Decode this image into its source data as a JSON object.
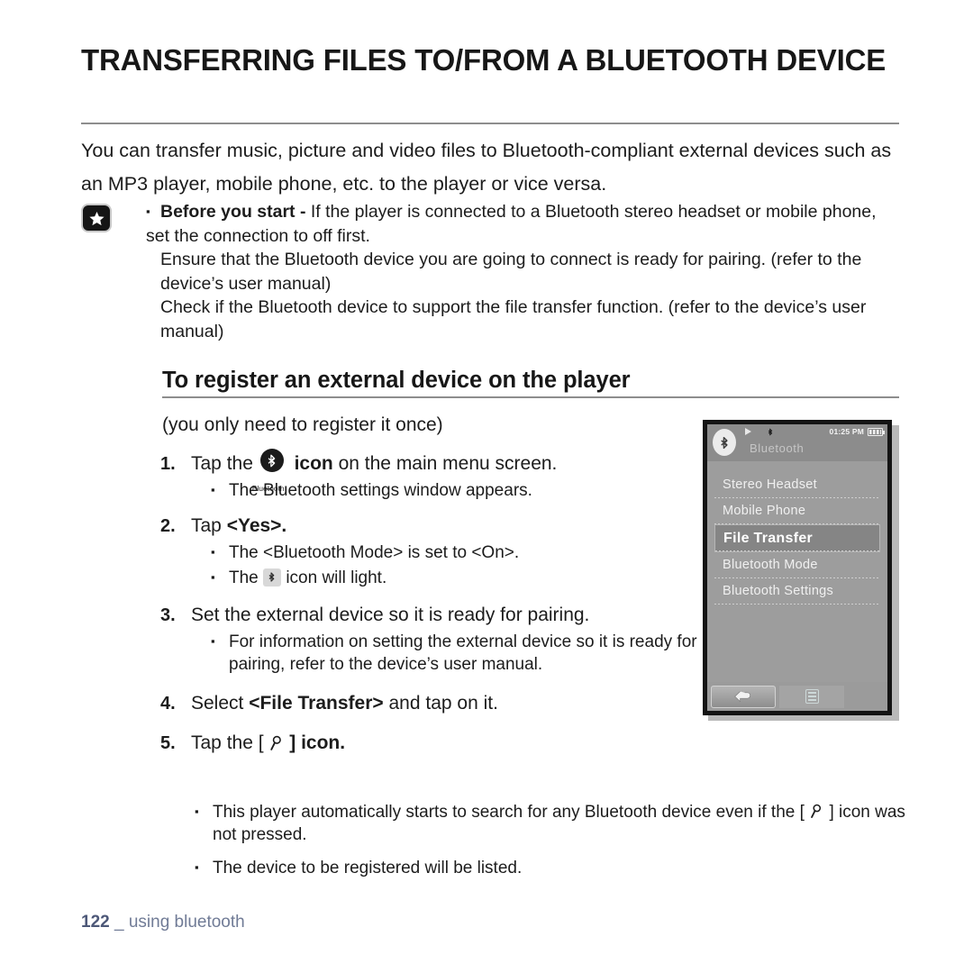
{
  "heading": {
    "title": "TRANSFERRING FILES TO/FROM A BLUETOOTH DEVICE"
  },
  "intro": {
    "text": "You can transfer music, picture and video files to Bluetooth-compliant external devices such as an MP3 player, mobile phone, etc. to the player or vice versa."
  },
  "note": {
    "icon": "star-icon",
    "bullet_bold": "Before you start - ",
    "bullet_rest": "If the player is connected to a Bluetooth stereo headset or mobile phone, set the connection to off first.",
    "line2": "Ensure that the Bluetooth device you are going to connect is ready for pairing. (refer to the device’s user manual)",
    "line3": "Check if the Bluetooth device to support the file transfer function. (refer to the device’s user manual)"
  },
  "section": {
    "subtitle": "To register an external device on the player",
    "paren_note": "(you only need to register it once)"
  },
  "steps": [
    {
      "num": "1.",
      "pre": "Tap the",
      "icon": "bluetooth-icon",
      "icon_label": "Bluetooth",
      "post_bold": "icon",
      "post": "on the main menu screen.",
      "bullets": [
        "The Bluetooth settings window appears."
      ]
    },
    {
      "num": "2.",
      "pre": "Tap",
      "bold": "<Yes>.",
      "bullets": [
        "The <Bluetooth Mode> is set to <On>."
      ],
      "bullet_icon_pre": "The",
      "bullet_icon": "bluetooth-small-icon",
      "bullet_icon_post": "icon will light."
    },
    {
      "num": "3.",
      "text": "Set the external device so it is ready for pairing.",
      "bullets": [
        "For information on setting the external device so it is ready for pairing, refer to the device’s user manual."
      ]
    },
    {
      "num": "4.",
      "pre": "Select",
      "bold": "<File Transfer>",
      "post": "and tap on it."
    },
    {
      "num": "5.",
      "pre": "Tap the [",
      "icon": "search-icon",
      "post_bold": "] icon."
    }
  ],
  "final_bullets": {
    "b1_pre": "This player automatically starts to search for any Bluetooth device even if the [",
    "b1_icon": "search-icon",
    "b1_post": "] icon was not pressed.",
    "b2": "The device to be registered will be listed."
  },
  "device": {
    "status": {
      "play_icon": "play-icon",
      "bluetooth_icon": "bluetooth-icon",
      "time": "01:25 PM",
      "battery_icon": "battery-full-icon"
    },
    "title": "Bluetooth",
    "badge_icon": "bluetooth-badge-icon",
    "menu_items": [
      {
        "label": "Stereo Headset",
        "selected": false
      },
      {
        "label": "Mobile Phone",
        "selected": false
      },
      {
        "label": "File Transfer",
        "selected": true
      },
      {
        "label": "Bluetooth Mode",
        "selected": false
      },
      {
        "label": "Bluetooth Settings",
        "selected": false
      }
    ],
    "bottom": {
      "back_icon": "back-arrow-icon",
      "menu_icon": "list-menu-icon"
    }
  },
  "footer": {
    "page": "122",
    "separator": "_",
    "label": "using bluetooth"
  },
  "colors": {
    "rule": "#8d8d8d",
    "footer_text": "#707b96",
    "device_bg": "#9d9d9d",
    "device_selected": "#858585"
  }
}
